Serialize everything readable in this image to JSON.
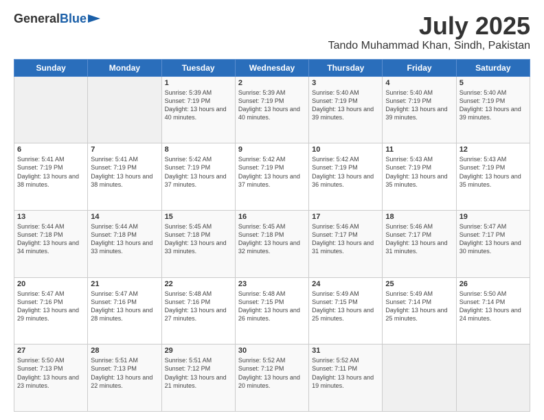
{
  "logo": {
    "general": "General",
    "blue": "Blue"
  },
  "header": {
    "month": "July 2025",
    "location": "Tando Muhammad Khan, Sindh, Pakistan"
  },
  "weekdays": [
    "Sunday",
    "Monday",
    "Tuesday",
    "Wednesday",
    "Thursday",
    "Friday",
    "Saturday"
  ],
  "weeks": [
    [
      {
        "day": "",
        "empty": true
      },
      {
        "day": "",
        "empty": true
      },
      {
        "day": "1",
        "sunrise": "5:39 AM",
        "sunset": "7:19 PM",
        "daylight": "13 hours and 40 minutes."
      },
      {
        "day": "2",
        "sunrise": "5:39 AM",
        "sunset": "7:19 PM",
        "daylight": "13 hours and 40 minutes."
      },
      {
        "day": "3",
        "sunrise": "5:40 AM",
        "sunset": "7:19 PM",
        "daylight": "13 hours and 39 minutes."
      },
      {
        "day": "4",
        "sunrise": "5:40 AM",
        "sunset": "7:19 PM",
        "daylight": "13 hours and 39 minutes."
      },
      {
        "day": "5",
        "sunrise": "5:40 AM",
        "sunset": "7:19 PM",
        "daylight": "13 hours and 39 minutes."
      }
    ],
    [
      {
        "day": "6",
        "sunrise": "5:41 AM",
        "sunset": "7:19 PM",
        "daylight": "13 hours and 38 minutes."
      },
      {
        "day": "7",
        "sunrise": "5:41 AM",
        "sunset": "7:19 PM",
        "daylight": "13 hours and 38 minutes."
      },
      {
        "day": "8",
        "sunrise": "5:42 AM",
        "sunset": "7:19 PM",
        "daylight": "13 hours and 37 minutes."
      },
      {
        "day": "9",
        "sunrise": "5:42 AM",
        "sunset": "7:19 PM",
        "daylight": "13 hours and 37 minutes."
      },
      {
        "day": "10",
        "sunrise": "5:42 AM",
        "sunset": "7:19 PM",
        "daylight": "13 hours and 36 minutes."
      },
      {
        "day": "11",
        "sunrise": "5:43 AM",
        "sunset": "7:19 PM",
        "daylight": "13 hours and 35 minutes."
      },
      {
        "day": "12",
        "sunrise": "5:43 AM",
        "sunset": "7:19 PM",
        "daylight": "13 hours and 35 minutes."
      }
    ],
    [
      {
        "day": "13",
        "sunrise": "5:44 AM",
        "sunset": "7:18 PM",
        "daylight": "13 hours and 34 minutes."
      },
      {
        "day": "14",
        "sunrise": "5:44 AM",
        "sunset": "7:18 PM",
        "daylight": "13 hours and 33 minutes."
      },
      {
        "day": "15",
        "sunrise": "5:45 AM",
        "sunset": "7:18 PM",
        "daylight": "13 hours and 33 minutes."
      },
      {
        "day": "16",
        "sunrise": "5:45 AM",
        "sunset": "7:18 PM",
        "daylight": "13 hours and 32 minutes."
      },
      {
        "day": "17",
        "sunrise": "5:46 AM",
        "sunset": "7:17 PM",
        "daylight": "13 hours and 31 minutes."
      },
      {
        "day": "18",
        "sunrise": "5:46 AM",
        "sunset": "7:17 PM",
        "daylight": "13 hours and 31 minutes."
      },
      {
        "day": "19",
        "sunrise": "5:47 AM",
        "sunset": "7:17 PM",
        "daylight": "13 hours and 30 minutes."
      }
    ],
    [
      {
        "day": "20",
        "sunrise": "5:47 AM",
        "sunset": "7:16 PM",
        "daylight": "13 hours and 29 minutes."
      },
      {
        "day": "21",
        "sunrise": "5:47 AM",
        "sunset": "7:16 PM",
        "daylight": "13 hours and 28 minutes."
      },
      {
        "day": "22",
        "sunrise": "5:48 AM",
        "sunset": "7:16 PM",
        "daylight": "13 hours and 27 minutes."
      },
      {
        "day": "23",
        "sunrise": "5:48 AM",
        "sunset": "7:15 PM",
        "daylight": "13 hours and 26 minutes."
      },
      {
        "day": "24",
        "sunrise": "5:49 AM",
        "sunset": "7:15 PM",
        "daylight": "13 hours and 25 minutes."
      },
      {
        "day": "25",
        "sunrise": "5:49 AM",
        "sunset": "7:14 PM",
        "daylight": "13 hours and 25 minutes."
      },
      {
        "day": "26",
        "sunrise": "5:50 AM",
        "sunset": "7:14 PM",
        "daylight": "13 hours and 24 minutes."
      }
    ],
    [
      {
        "day": "27",
        "sunrise": "5:50 AM",
        "sunset": "7:13 PM",
        "daylight": "13 hours and 23 minutes."
      },
      {
        "day": "28",
        "sunrise": "5:51 AM",
        "sunset": "7:13 PM",
        "daylight": "13 hours and 22 minutes."
      },
      {
        "day": "29",
        "sunrise": "5:51 AM",
        "sunset": "7:12 PM",
        "daylight": "13 hours and 21 minutes."
      },
      {
        "day": "30",
        "sunrise": "5:52 AM",
        "sunset": "7:12 PM",
        "daylight": "13 hours and 20 minutes."
      },
      {
        "day": "31",
        "sunrise": "5:52 AM",
        "sunset": "7:11 PM",
        "daylight": "13 hours and 19 minutes."
      },
      {
        "day": "",
        "empty": true
      },
      {
        "day": "",
        "empty": true
      }
    ]
  ]
}
